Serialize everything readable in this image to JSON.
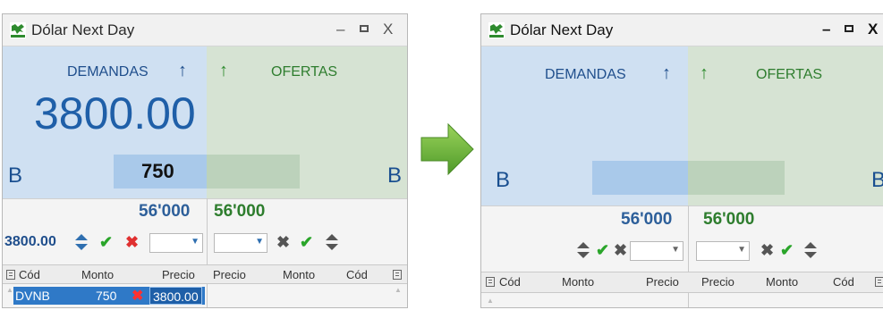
{
  "left_panel": {
    "title": "Dólar Next Day",
    "controls": {
      "minimize": "–",
      "maximize": "▫",
      "close": "X"
    },
    "demandas_label": "DEMANDAS",
    "ofertas_label": "OFERTAS",
    "big_price": "3800.00",
    "side_letter_left": "B",
    "side_letter_right": "B",
    "bid_qty": "750",
    "total_demand": "56'000",
    "total_offer": "56'000",
    "price_input": "3800.00",
    "headers_left": [
      "Cód",
      "Monto",
      "Precio"
    ],
    "headers_right": [
      "Precio",
      "Monto",
      "Cód"
    ],
    "order": {
      "code": "DVNB",
      "amount": "750",
      "price": "3800.00"
    }
  },
  "right_panel": {
    "title": "Dólar Next Day",
    "controls": {
      "minimize": "–",
      "maximize": "▫",
      "close": "X"
    },
    "demandas_label": "DEMANDAS",
    "ofertas_label": "OFERTAS",
    "side_letter_left": "B",
    "side_letter_right": "B",
    "total_demand": "56'000",
    "total_offer": "56'000",
    "headers_left": [
      "Cód",
      "Monto",
      "Precio"
    ],
    "headers_right": [
      "Precio",
      "Monto",
      "Cód"
    ]
  },
  "icons": {
    "up_arrow": "↑",
    "check": "✔",
    "cancel": "✖",
    "dropdown": "▼",
    "transition": "right-arrow-icon"
  },
  "colors": {
    "demand_bg": "#cfe0f2",
    "offer_bg": "#d6e3d3",
    "demand_text": "#1f4e8c",
    "offer_text": "#2e7d2e",
    "selected_row": "#2f79c7"
  }
}
